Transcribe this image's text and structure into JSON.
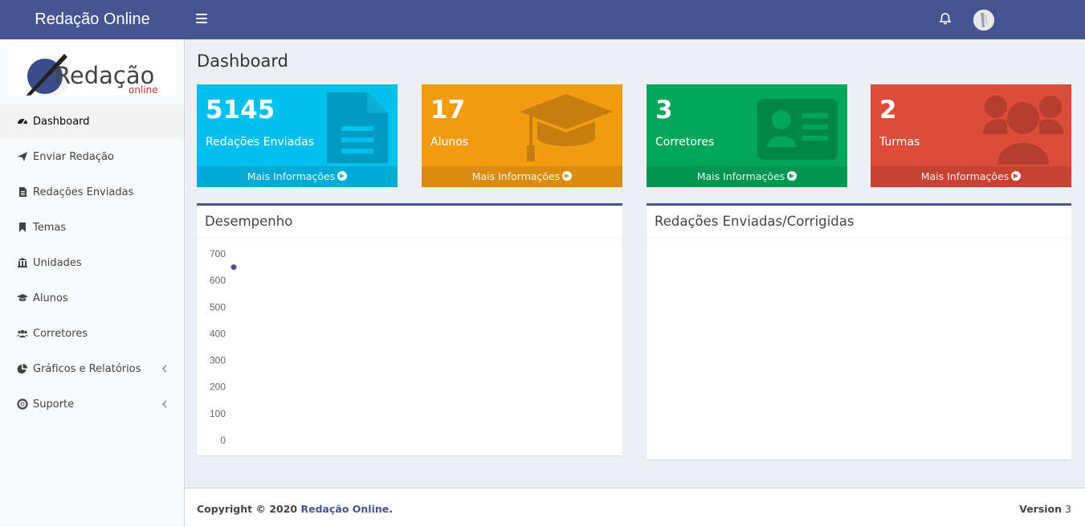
{
  "header": {
    "brand": "Redação Online",
    "menu_icon": "bars-icon",
    "notification_icon": "bell-icon",
    "avatar_icon": "user-avatar"
  },
  "logo": {
    "text_main": "Redação",
    "text_sub": "online"
  },
  "sidebar": {
    "items": [
      {
        "label": "Dashboard",
        "icon": "dashboard-icon",
        "active": true
      },
      {
        "label": "Enviar Redação",
        "icon": "paper-plane-icon"
      },
      {
        "label": "Redações Enviadas",
        "icon": "file-text-icon"
      },
      {
        "label": "Temas",
        "icon": "bookmark-icon"
      },
      {
        "label": "Unidades",
        "icon": "bank-icon"
      },
      {
        "label": "Alunos",
        "icon": "graduation-cap-icon"
      },
      {
        "label": "Corretores",
        "icon": "users-icon"
      },
      {
        "label": "Gráficos e Relatórios",
        "icon": "pie-chart-icon",
        "submenu": true
      },
      {
        "label": "Suporte",
        "icon": "life-ring-icon",
        "submenu": true
      }
    ]
  },
  "page": {
    "title": "Dashboard"
  },
  "stats": [
    {
      "number": "5145",
      "label": "Redações Enviadas",
      "link": "Mais Informações",
      "color": "#00c0ef",
      "icon": "file-icon"
    },
    {
      "number": "17",
      "label": "Alunos",
      "link": "Mais Informações",
      "color": "#f39c12",
      "icon": "graduation-cap-icon"
    },
    {
      "number": "3",
      "label": "Corretores",
      "link": "Mais Informações",
      "color": "#00a65a",
      "icon": "id-card-icon"
    },
    {
      "number": "2",
      "label": "Turmas",
      "link": "Mais Informações",
      "color": "#dd4b39",
      "icon": "users-icon"
    }
  ],
  "panels": {
    "performance": {
      "title": "Desempenho"
    },
    "submissions": {
      "title": "Redações Enviadas/Corrigidas"
    }
  },
  "chart_data": {
    "type": "scatter",
    "title": "Desempenho",
    "y_ticks": [
      "700",
      "600",
      "500",
      "400",
      "300",
      "200",
      "100",
      "0"
    ],
    "ylim": [
      0,
      700
    ],
    "points": [
      {
        "y": 650
      }
    ],
    "color": "#455591"
  },
  "footer": {
    "copyright_prefix": "Copyright © 2020 ",
    "copyright_link": "Redação Online",
    "copyright_suffix": ".",
    "version_label": "Version",
    "version_value": "3"
  }
}
